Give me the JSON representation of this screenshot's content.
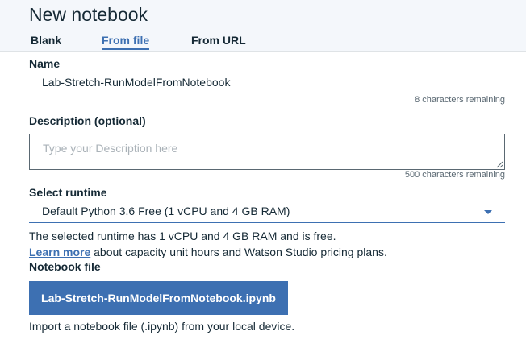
{
  "header": {
    "title": "New notebook",
    "tabs": [
      {
        "label": "Blank"
      },
      {
        "label": "From file"
      },
      {
        "label": "From URL"
      }
    ]
  },
  "form": {
    "name": {
      "label": "Name",
      "value": "Lab-Stretch-RunModelFromNotebook",
      "counter": "8 characters remaining"
    },
    "description": {
      "label": "Description (optional)",
      "placeholder": "Type your Description here",
      "counter": "500 characters remaining"
    },
    "runtime": {
      "label": "Select runtime",
      "selected": "Default Python 3.6 Free (1 vCPU and 4 GB RAM)",
      "info": "The selected runtime has 1 vCPU and 4 GB RAM and is free.",
      "learn_more_link": "Learn more",
      "learn_more_text": " about capacity unit hours and Watson Studio pricing plans."
    },
    "notebook_file": {
      "label": "Notebook file",
      "button_label": "Lab-Stretch-RunModelFromNotebook.ipynb",
      "help": "Import a notebook file (.ipynb) from your local device."
    }
  },
  "colors": {
    "accent": "#3d70b2",
    "text": "#152935",
    "header_bg": "#f4f7fb"
  }
}
